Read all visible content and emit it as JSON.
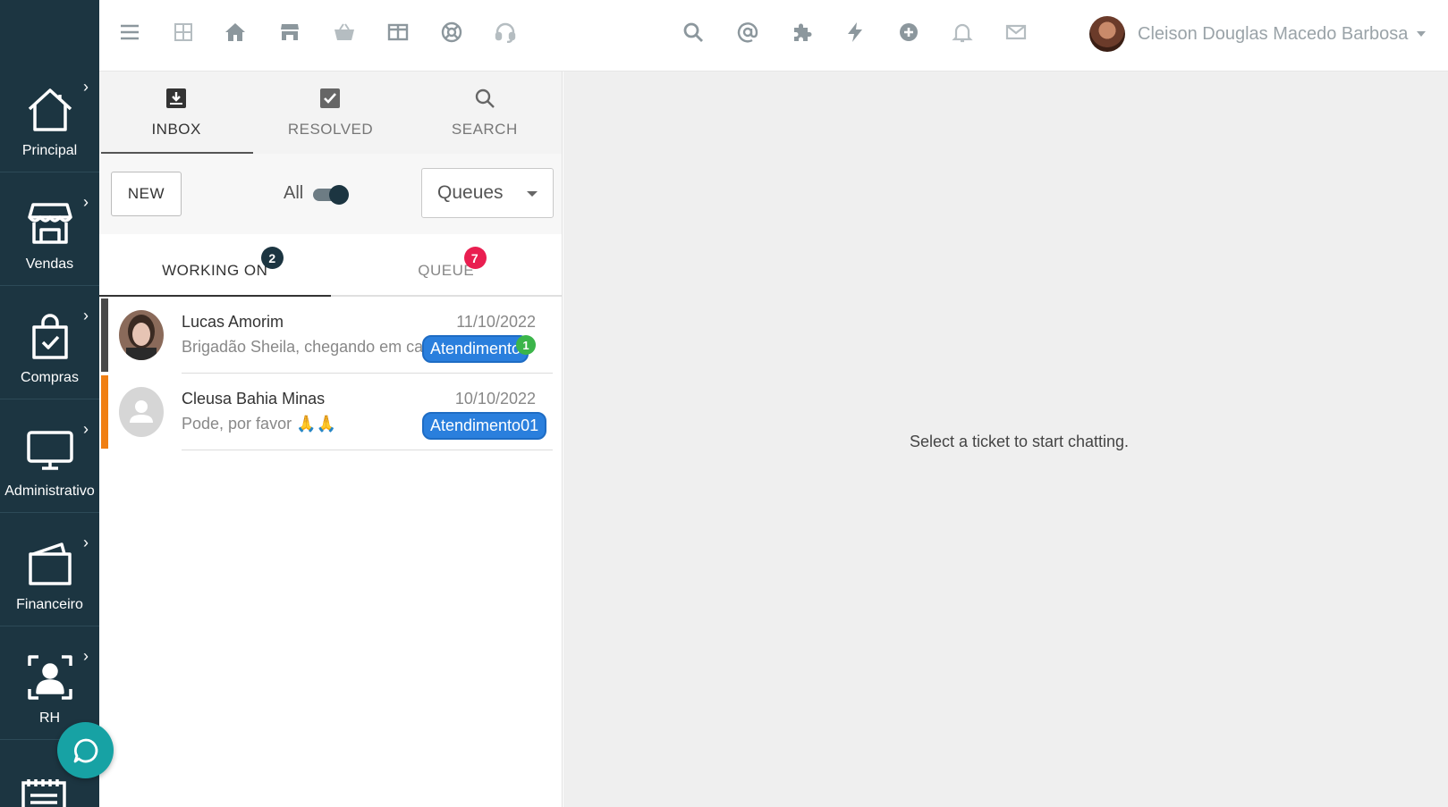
{
  "sidebar": {
    "items": [
      {
        "label": "Principal",
        "icon": "home-icon"
      },
      {
        "label": "Vendas",
        "icon": "store-icon"
      },
      {
        "label": "Compras",
        "icon": "shopping-bag-check-icon"
      },
      {
        "label": "Administrativo",
        "icon": "monitor-icon"
      },
      {
        "label": "Financeiro",
        "icon": "wallet-icon"
      },
      {
        "label": "RH",
        "icon": "user-focus-icon"
      }
    ],
    "chat_button_icon": "chat-bubble-icon"
  },
  "topbar": {
    "left_icons": [
      "menu-icon",
      "grid-icon",
      "home-icon",
      "store-icon",
      "basket-icon",
      "columns-icon",
      "lifebuoy-icon",
      "headset-icon"
    ],
    "right_icons": [
      "search-icon",
      "at-icon",
      "puzzle-icon",
      "bolt-icon",
      "plus-circle-icon",
      "bell-icon",
      "mail-icon"
    ],
    "user_name": "Cleison Douglas Macedo Barbosa"
  },
  "tabs": {
    "inbox": "INBOX",
    "resolved": "RESOLVED",
    "search": "SEARCH"
  },
  "filters": {
    "new_label": "NEW",
    "all_label": "All",
    "all_toggle_on": true,
    "queues_label": "Queues"
  },
  "subtabs": {
    "working_on": "WORKING ON",
    "working_on_count": "2",
    "queue": "QUEUE",
    "queue_count": "7"
  },
  "tickets": [
    {
      "name": "Lucas Amorim",
      "date": "11/10/2022",
      "message": "Brigadão Sheila, chegando em casa",
      "queue": "Atendimento",
      "unread": "1",
      "bar_color": "#4a4a4a"
    },
    {
      "name": "Cleusa Bahia Minas",
      "date": "10/10/2022",
      "message": "Pode, por favor 🙏🙏",
      "queue": "Atendimento01",
      "unread": "",
      "bar_color": "#f07f13"
    }
  ],
  "chat": {
    "placeholder": "Select a ticket to start chatting."
  },
  "colors": {
    "sidebar_bg": "#1c3541",
    "queue_chip": "#2a7fdd",
    "badge_red": "#e91e50",
    "unread_green": "#3bb54a",
    "fab": "#17a2a4"
  }
}
